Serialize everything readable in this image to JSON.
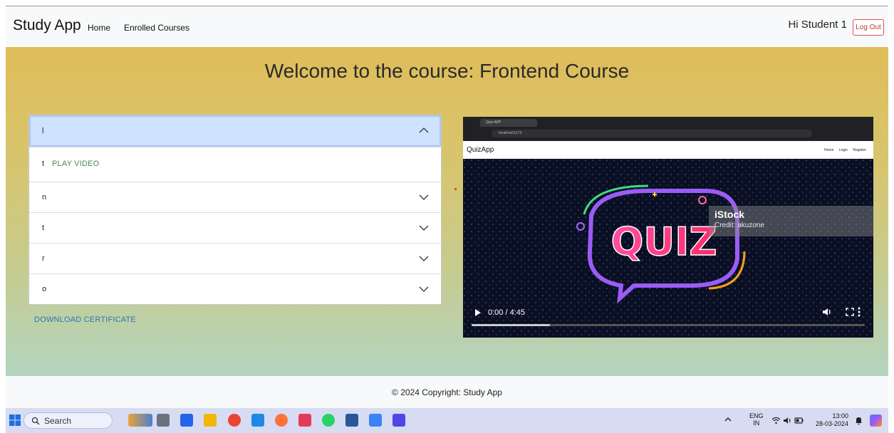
{
  "navbar": {
    "brand": "Study App",
    "links": [
      "Home",
      "Enrolled Courses"
    ],
    "greeting": "Hi Student 1",
    "logout_label": "Log Out"
  },
  "main": {
    "title": "Welcome to the course: Frontend Course",
    "accordion": {
      "items": [
        {
          "label": "l",
          "expanded": true,
          "body_letter": "t",
          "play_label": "PLAY VIDEO"
        },
        {
          "label": "n",
          "expanded": false
        },
        {
          "label": "t",
          "expanded": false
        },
        {
          "label": "r",
          "expanded": false
        },
        {
          "label": "o",
          "expanded": false
        }
      ]
    },
    "certificate_label": "DOWNLOAD CERTIFICATE"
  },
  "video": {
    "browser_tab": "Quiz APP",
    "browser_url": "localhost:5173",
    "app_brand": "QuizApp",
    "app_links": [
      "Home",
      "Login",
      "Register"
    ],
    "art_text": "QUIZ",
    "watermark_name": "iStock",
    "watermark_credit": "Credit: akuzone",
    "time": "0:00 / 4:45",
    "progress_fraction": 0.2
  },
  "footer": {
    "copyright": "© 2024 Copyright: Study App"
  },
  "taskbar": {
    "search_label": "Search",
    "lang_top": "ENG",
    "lang_bottom": "IN",
    "time": "13:00",
    "date": "28-03-2024"
  },
  "colors": {
    "accent": "#cfe2ff",
    "link_green": "#4a8a4a",
    "link_blue": "#2f74b8",
    "logout_red": "#d9534f"
  }
}
